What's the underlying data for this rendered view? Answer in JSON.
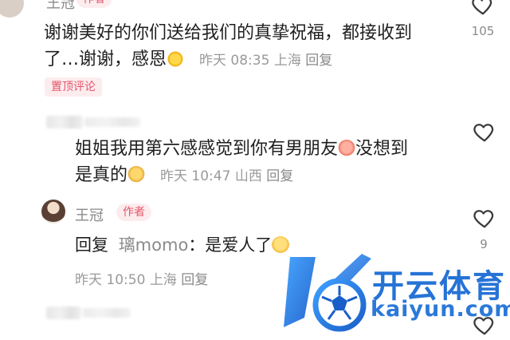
{
  "comment_top": {
    "username": "王冠",
    "author_tag": "作者",
    "content_line1": "谢谢美好的你们送给我们的真挚祝福，都接收到",
    "content_line2_text": "了…谢谢，感恩",
    "emoji": "sun-emoji",
    "time": "昨天 08:35",
    "location": "上海",
    "reply_label": "回复",
    "pin_label": "置顶评论",
    "like_count": "105"
  },
  "comment_second": {
    "content_line1": "姐姐我用第六感感觉到你有男朋友",
    "content_line1_tail": "没想到",
    "content_line2_text": "是真的",
    "emoji1": "blushing-emoji",
    "emoji2": "chick-emoji",
    "time": "昨天 10:47",
    "location": "山西",
    "reply_label": "回复"
  },
  "comment_author_reply": {
    "username": "王冠",
    "author_tag": "作者",
    "reply_prefix": "回复",
    "reply_target": "璃momo",
    "colon_text": "：是爱人了",
    "emoji": "smile-emoji",
    "time": "昨天 10:50",
    "location": "上海",
    "reply_label": "回复",
    "like_count": "9"
  },
  "watermark": {
    "brand": "开云体育",
    "url": "kaiyun.com"
  },
  "colors": {
    "author_accent": "#e4566b",
    "watermark_blue": "#2673d6"
  }
}
